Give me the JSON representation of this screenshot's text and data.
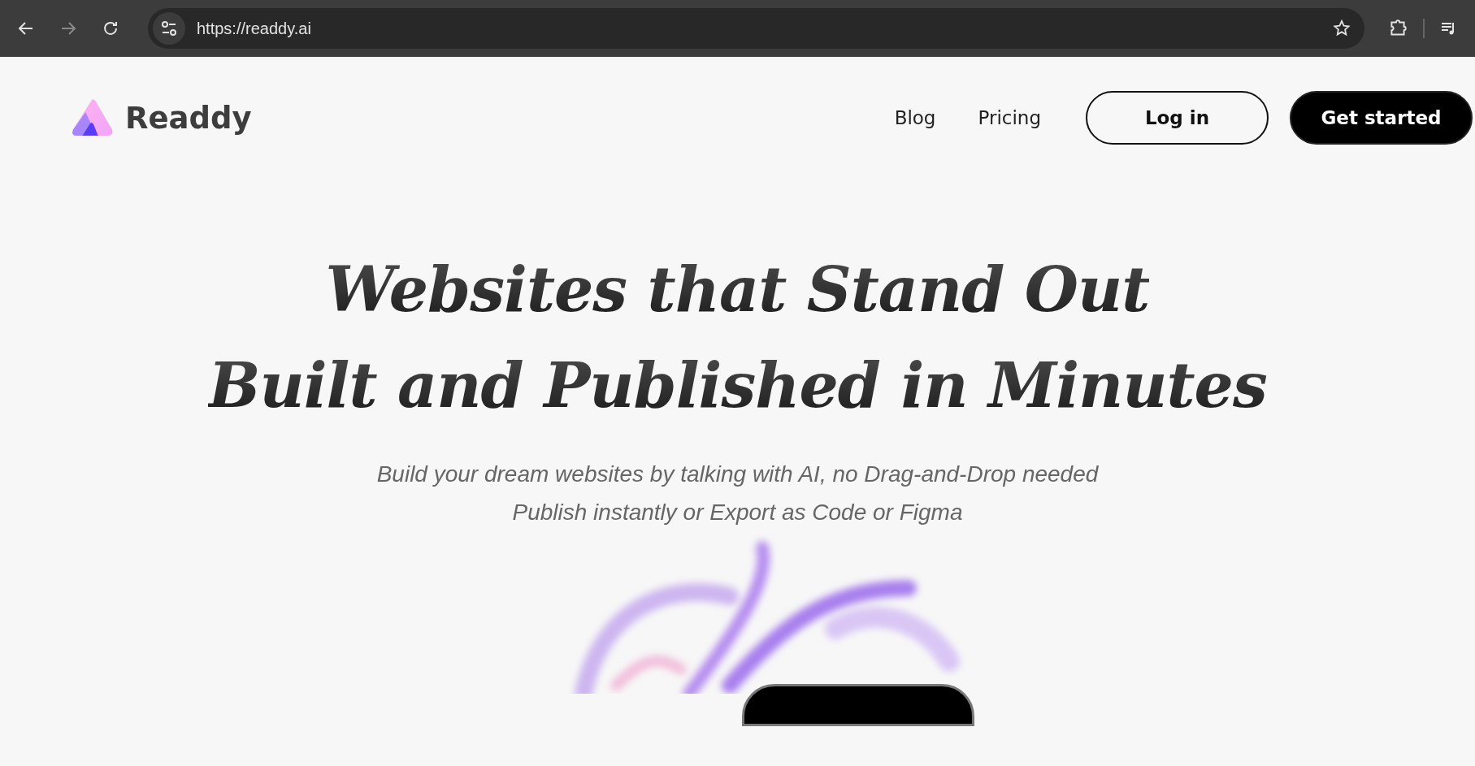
{
  "browser": {
    "url": "https://readdy.ai"
  },
  "header": {
    "brand": "Readdy",
    "nav": [
      "Blog",
      "Pricing"
    ],
    "login": "Log in",
    "cta": "Get started"
  },
  "hero": {
    "headline": [
      "Websites that Stand Out",
      "Built and Published in Minutes"
    ],
    "subtitle": [
      "Build your dream websites by talking with AI, no Drag-and-Drop needed",
      "Publish instantly or Export as Code or Figma"
    ]
  }
}
